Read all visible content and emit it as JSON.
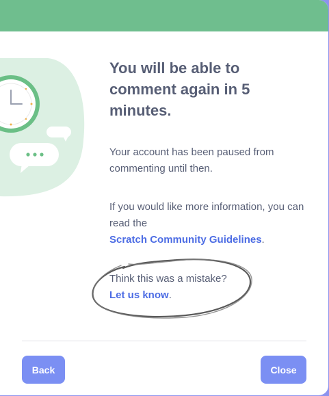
{
  "dialog": {
    "heading": "You will be able to comment again in 5 minutes.",
    "paused_text": "Your account has been paused from commenting until then.",
    "info_text": "If you would like more information, you can read the",
    "guidelines_link": "Scratch Community Guidelines",
    "guidelines_suffix": ".",
    "mistake_text": "Think this was a mistake?",
    "let_us_know_link": "Let us know",
    "let_us_know_suffix": "."
  },
  "buttons": {
    "back_label": "Back",
    "close_label": "Close"
  },
  "illustration": {
    "icons": [
      "clock-icon",
      "speech-bubble-icon"
    ]
  },
  "colors": {
    "header": "#6fbe8e",
    "heading_text": "#575e75",
    "link": "#4c6ce4",
    "button": "#7b8ff3",
    "illustration_bg": "#dcf0e3",
    "outer_background": "#8c93ee"
  }
}
